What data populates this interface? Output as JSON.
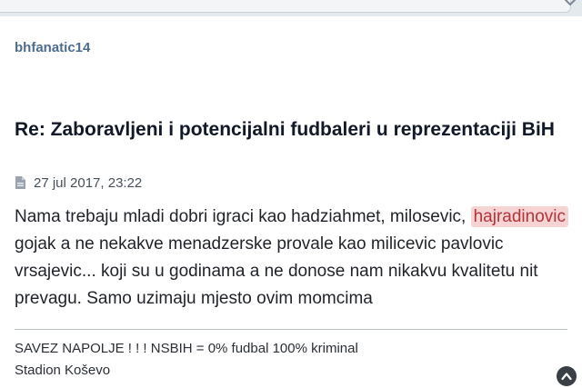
{
  "post": {
    "author": "bhfanatic14",
    "title": "Re: Zaboravljeni i potencijalni fudbaleri u reprezentaciji BiH",
    "date": "27 jul 2017, 23:22",
    "body": {
      "part1": "Nama trebaju mladi dobri igraci kao hadziahmet, milosevic, ",
      "highlight": "hajradinovic",
      "part2": " gojak a ne nekakve menadzerske provale kao milicevic pavlovic vrsajevic... koji su u godinama a ne donose nam nikakvu kvalitetu nit prevagu. Samo uzimaju mjesto ovim momcima"
    },
    "signature": {
      "line1": "SAVEZ NAPOLJE ! ! ! NSBIH = 0% fudbal 100% kriminal",
      "line2": "Stadion Koševo"
    }
  },
  "icons": {
    "post_icon": "file-icon",
    "scroll_top": "chevron-up-icon",
    "corner": "caret-down-icon"
  },
  "colors": {
    "author": "#4c6d8e",
    "highlight_bg": "#f6d4d4",
    "highlight_text": "#b3343a"
  }
}
